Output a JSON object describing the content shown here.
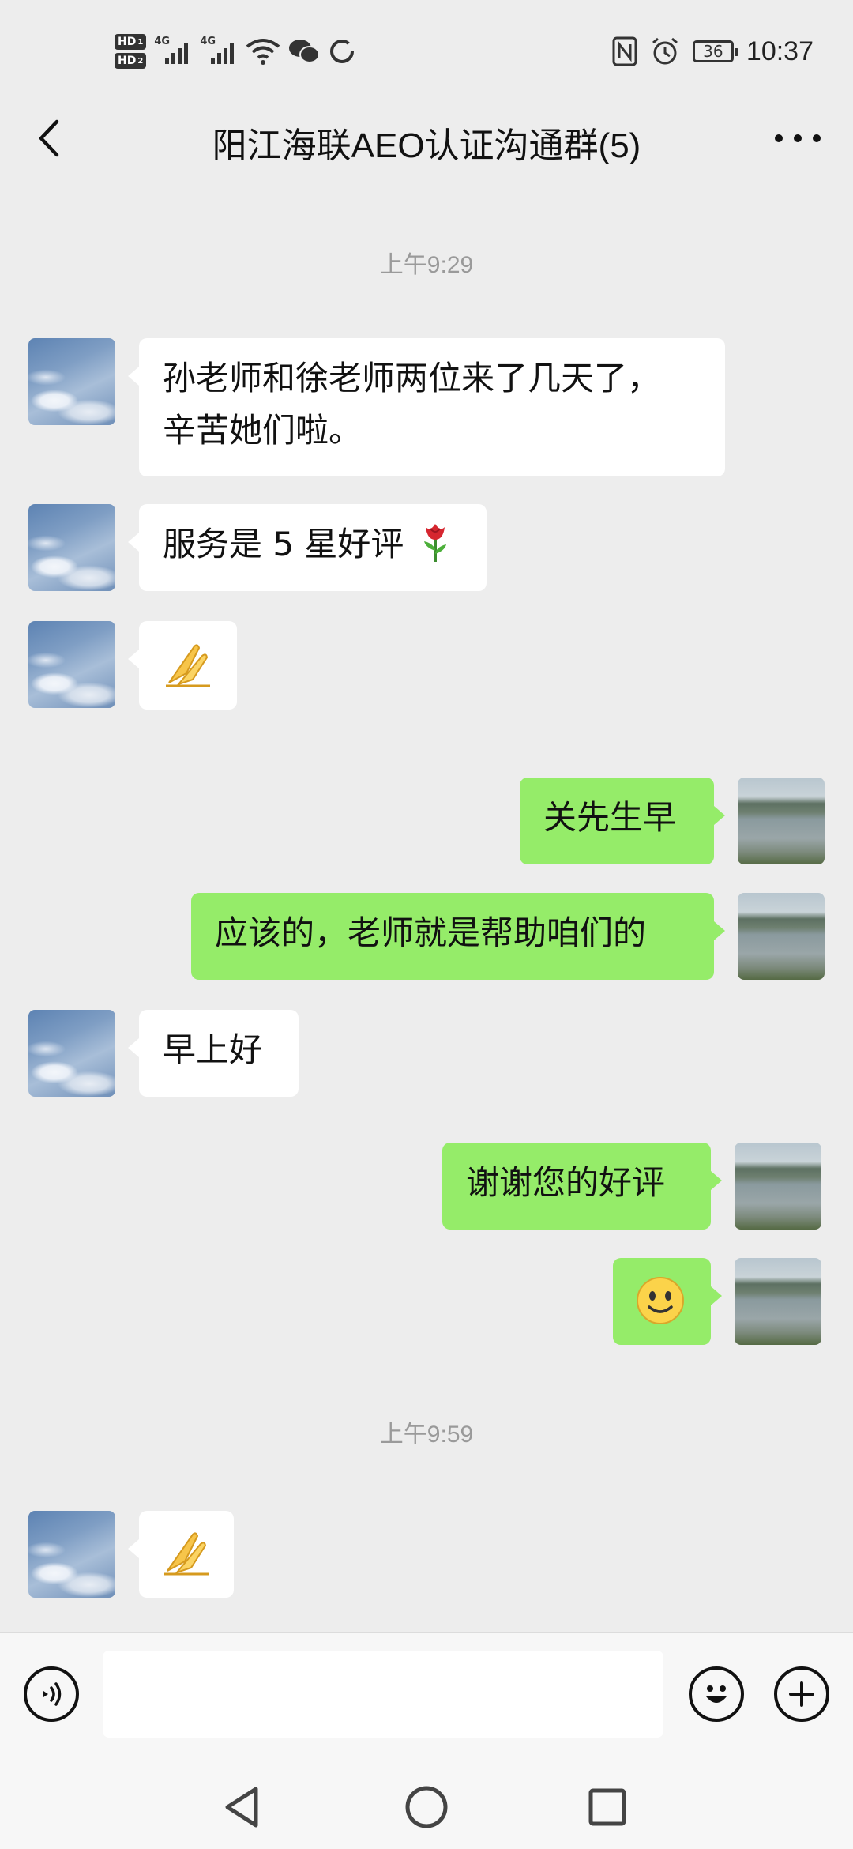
{
  "status_bar": {
    "hd1": "HD",
    "hd1_sub": "1",
    "hd2": "HD",
    "hd2_sub": "2",
    "signal1": "4G",
    "signal2": "4G",
    "battery": "36",
    "time": "10:37"
  },
  "header": {
    "title": "阳江海联AEO认证沟通群(5)"
  },
  "messages": [
    {
      "type": "time",
      "text": "上午9:29"
    },
    {
      "side": "in",
      "text_line1": "孙老师和徐老师两位来了几天了，",
      "text_line2": "辛苦她们啦。"
    },
    {
      "side": "in",
      "text": "服务是 5 星好评",
      "emoji": "rose-emoji"
    },
    {
      "side": "in",
      "emoji": "pray-hands-emoji"
    },
    {
      "side": "out",
      "text": "关先生早"
    },
    {
      "side": "out",
      "text": "应该的，老师就是帮助咱们的"
    },
    {
      "side": "in",
      "text": "早上好"
    },
    {
      "side": "out",
      "text": "谢谢您的好评"
    },
    {
      "side": "out",
      "emoji": "smile-emoji"
    },
    {
      "type": "time",
      "text": "上午9:59"
    },
    {
      "side": "in",
      "emoji": "pray-hands-emoji"
    }
  ],
  "input_bar": {
    "voice_icon": "voice-icon",
    "emoji_icon": "emoji-icon",
    "plus_icon": "plus-icon",
    "value": ""
  },
  "nav": [
    "back-triangle-icon",
    "home-circle-icon",
    "recents-square-icon"
  ],
  "colors": {
    "background": "#ededed",
    "outgoing_bubble": "#95ec69",
    "incoming_bubble": "#ffffff",
    "timestamp": "#9a9a9a"
  }
}
